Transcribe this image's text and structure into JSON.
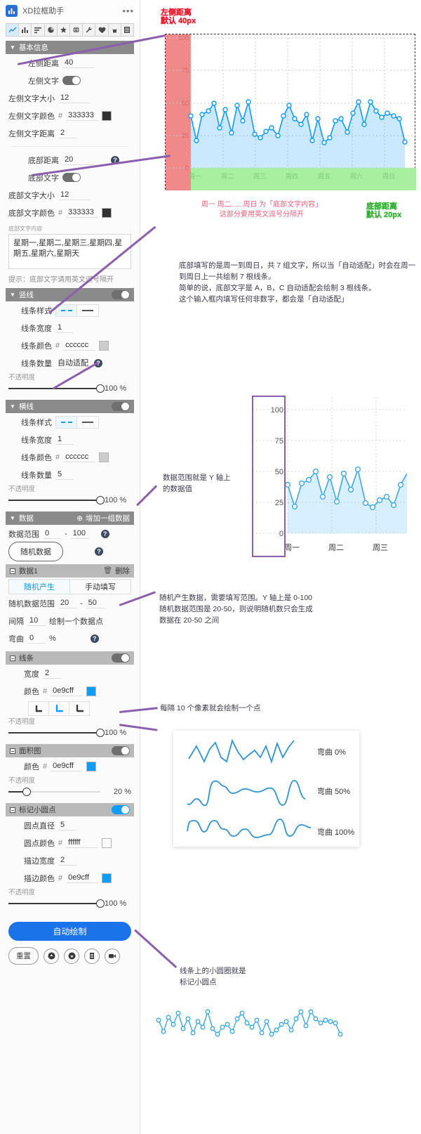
{
  "app": {
    "title": "XD拉框助手",
    "logo_icon": "chart-logo-icon",
    "menu_dots": "•••",
    "toolbar": [
      {
        "name": "line-chart-tool",
        "glyph": "↗",
        "active": true
      },
      {
        "name": "bar-chart-tool",
        "glyph": "█",
        "active": false
      },
      {
        "name": "list-tool",
        "glyph": "≡",
        "active": false
      },
      {
        "name": "pie-chart-tool",
        "glyph": "◔",
        "active": false
      },
      {
        "name": "star-tool",
        "glyph": "★",
        "active": false
      },
      {
        "name": "globe-tool",
        "glyph": "⊕",
        "active": false
      },
      {
        "name": "wrench-tool",
        "glyph": "⚒",
        "active": false
      },
      {
        "name": "heart-tool",
        "glyph": "♥",
        "active": false
      },
      {
        "name": "animal-tool",
        "glyph": "☘",
        "active": false
      },
      {
        "name": "page-tool",
        "glyph": "▤",
        "active": false
      }
    ]
  },
  "basic": {
    "title": "基本信息",
    "left_distance_label": "左侧距离",
    "left_distance_value": "40",
    "left_text_label": "左侧文字",
    "left_text_on": true,
    "left_font_size_label": "左侧文字大小",
    "left_font_size_value": "12",
    "left_font_color_label": "左侧文字颜色",
    "left_font_color_value": "333333",
    "left_font_color_hex": "#333333",
    "left_text_gap_label": "左侧文字距离",
    "left_text_gap_value": "2",
    "bottom_distance_label": "底部距离",
    "bottom_distance_value": "20",
    "bottom_text_label": "底部文字",
    "bottom_text_on": true,
    "bottom_font_size_label": "底部文字大小",
    "bottom_font_size_value": "12",
    "bottom_font_color_label": "底部文字颜色",
    "bottom_font_color_value": "333333",
    "bottom_font_color_hex": "#333333",
    "bottom_text_content_label": "底部文字内容",
    "bottom_text_content_value": "星期一,星期二,星期三,星期四,星期五,星期六,星期天",
    "tip": "提示：底部文字请用英文逗号隔开"
  },
  "vlines": {
    "title": "竖线",
    "enabled": true,
    "style_label": "线条样式",
    "style_selected": "dashed",
    "width_label": "线条宽度",
    "width_value": "1",
    "color_label": "线条颜色",
    "color_value": "cccccc",
    "color_hex": "#cccccc",
    "count_label": "线条数量",
    "count_value": "自动适配",
    "opacity_label": "不透明度",
    "opacity_value": "100",
    "opacity_unit": "%"
  },
  "hlines": {
    "title": "横线",
    "enabled": true,
    "style_label": "线条样式",
    "style_selected": "dashed",
    "width_label": "线条宽度",
    "width_value": "1",
    "color_label": "线条颜色",
    "color_value": "cccccc",
    "color_hex": "#cccccc",
    "count_label": "线条数量",
    "count_value": "5",
    "opacity_label": "不透明度",
    "opacity_value": "100",
    "opacity_unit": "%"
  },
  "dataset": {
    "title": "数据",
    "add_label": "增加一组数据",
    "range_label": "数据范围",
    "range_min": "0",
    "range_dash": "-",
    "range_max": "100",
    "random_button": "随机数据",
    "item_title": "数据1",
    "delete_label": "删除",
    "mode_random": "随机产生",
    "mode_manual": "手动填写",
    "mode_selected": "随机产生",
    "rand_range_label": "随机数据范围",
    "rand_min": "20",
    "rand_dash": "-",
    "rand_max": "50",
    "interval_label": "间隔",
    "interval_value": "10",
    "interval_suffix": "绘制一个数据点",
    "bend_label": "弯曲",
    "bend_value": "0",
    "bend_unit": "%"
  },
  "line_style": {
    "title": "线条",
    "enabled": true,
    "width_label": "宽度",
    "width_value": "2",
    "color_label": "颜色",
    "color_value": "0e9cff",
    "color_hex": "#0e9cff",
    "cap_selected": 1,
    "caps": [
      "⌞",
      "⤵",
      "⤵"
    ],
    "opacity_label": "不透明度",
    "opacity_value": "100",
    "opacity_unit": "%"
  },
  "area_style": {
    "title": "面积图",
    "enabled": true,
    "color_label": "颜色",
    "color_value": "0e9cff",
    "color_hex": "#0e9cff",
    "opacity_label": "不透明度",
    "opacity_value": "20",
    "opacity_unit": "%"
  },
  "dots_style": {
    "title": "标记小圆点",
    "enabled": true,
    "diameter_label": "圆点直径",
    "diameter_value": "5",
    "dot_color_label": "圆点颜色",
    "dot_color_value": "ffffff",
    "dot_color_hex": "#ffffff",
    "stroke_width_label": "描边宽度",
    "stroke_width_value": "2",
    "stroke_color_label": "描边颜色",
    "stroke_color_value": "0e9cff",
    "stroke_color_hex": "#0e9cff",
    "opacity_label": "不透明度",
    "opacity_value": "100",
    "opacity_unit": "%"
  },
  "footer": {
    "draw_button": "自动绘制",
    "reset_button": "重置",
    "icon_buttons": [
      "upload-icon",
      "download-icon",
      "file-icon",
      "video-icon"
    ],
    "icon_glyphs": [
      "▲",
      "▼",
      "▤",
      "▶"
    ]
  },
  "annotations": {
    "left_distance_note": "左侧距离\n默认 40px",
    "bottom_distance_note": "底部距离\n默认 20px",
    "axis_note": "周一 周二......周日 为「底部文字内容」\n这部分要用英文逗号分隔开",
    "autofit_note": "底部填写的是周一到周日，共 7 组文字，所以当「自动适配」时会在周一到周日上一共绘制 7 根线条。\n简单的说，底部文字是 A，B，C 自动适配会绘制 3 根线条。\n这个输入框内填写任何非数字，都会是「自动适配」",
    "yaxis_note": "数据范围就是 Y 轴上\n的数据值",
    "random_note": "随机产生数据，需要填写范围。Y 轴上是 0-100\n随机数据范围是 20-50，则说明随机数只会生成\n数据在 20-50 之间",
    "interval_note": "每隔 10 个像素就会绘制一个点",
    "dots_note": "线条上的小圆圈就是\n标记小圆点"
  },
  "chart_data": {
    "type": "line",
    "title": "",
    "xlabel": "",
    "ylabel": "",
    "ylim": [
      0,
      100
    ],
    "yticks": [
      0,
      25,
      50,
      75,
      100
    ],
    "categories": [
      "周一",
      "周二",
      "周三",
      "周四",
      "周五",
      "周六",
      "周日"
    ],
    "grid": true,
    "legend": "none",
    "series": [
      {
        "name": "数据1",
        "color": "#0e9cff",
        "values": [
          39,
          21,
          41,
          44,
          50,
          31,
          45,
          27,
          48,
          36,
          51,
          28,
          23,
          28,
          30,
          24,
          39,
          47,
          37,
          33,
          41,
          21,
          37,
          20,
          23,
          35,
          37,
          27,
          41,
          51,
          34,
          51,
          44,
          38,
          41,
          39,
          37,
          20
        ]
      }
    ]
  },
  "chart_zoom": {
    "type": "line",
    "yticks": [
      0,
      25,
      50,
      75,
      100
    ],
    "categories": [
      "周一",
      "周二",
      "周三"
    ],
    "values": [
      39,
      21,
      41,
      44,
      50,
      31,
      45,
      27,
      48,
      36,
      51,
      28,
      23,
      28,
      30,
      24,
      39,
      47
    ]
  },
  "curve_samples": {
    "title": "",
    "items": [
      {
        "label": "弯曲 0%",
        "bend": 0
      },
      {
        "label": "弯曲 50%",
        "bend": 50
      },
      {
        "label": "弯曲 100%",
        "bend": 100
      }
    ]
  },
  "dots_preview": {
    "color": "#0e9cff",
    "values": [
      38,
      28,
      42,
      34,
      46,
      30,
      44,
      26,
      40,
      33,
      48,
      30,
      24,
      30,
      32,
      26,
      40,
      46,
      38,
      34,
      42,
      24,
      38,
      22,
      26,
      36,
      38,
      28,
      42,
      50,
      35,
      50,
      44,
      39,
      42,
      40,
      38,
      22
    ]
  }
}
